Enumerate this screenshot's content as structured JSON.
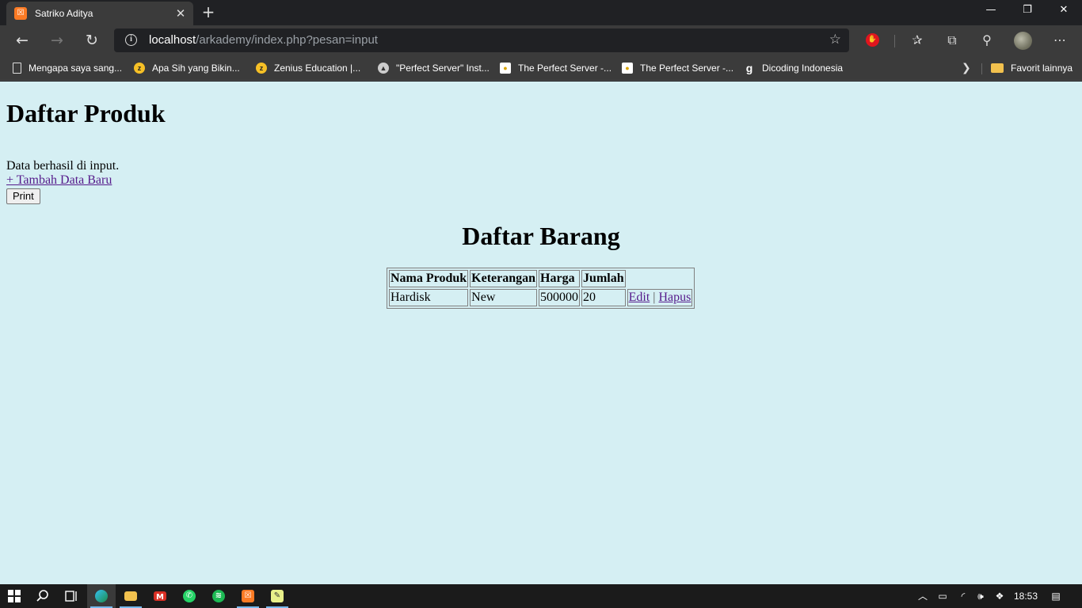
{
  "browser": {
    "tab_title": "Satriko Aditya",
    "url_host": "localhost",
    "url_path": "/arkademy/index.php?pesan=input"
  },
  "bookmarks": [
    {
      "label": "Mengapa saya sang...",
      "icon": "page-icon"
    },
    {
      "label": "Apa Sih yang Bikin...",
      "icon": "zenius-icon"
    },
    {
      "label": "Zenius Education |...",
      "icon": "zenius-icon"
    },
    {
      "label": "\"Perfect Server\" Inst...",
      "icon": "compass-icon"
    },
    {
      "label": "The Perfect Server -...",
      "icon": "bulb-icon"
    },
    {
      "label": "The Perfect Server -...",
      "icon": "bulb-icon"
    },
    {
      "label": "Dicoding Indonesia",
      "icon": "dicoding-icon"
    }
  ],
  "bookmarks_other": "Favorit lainnya",
  "page": {
    "title": "Daftar Produk",
    "message": "Data berhasil di input.",
    "add_link": "+ Tambah Data Baru",
    "print_button": "Print",
    "section_title": "Daftar Barang",
    "table": {
      "headers": [
        "Nama Produk",
        "Keterangan",
        "Harga",
        "Jumlah"
      ],
      "rows": [
        {
          "nama": "Hardisk",
          "keterangan": "New",
          "harga": "500000",
          "jumlah": "20",
          "edit": "Edit",
          "separator": "|",
          "hapus": "Hapus"
        }
      ]
    }
  },
  "taskbar": {
    "clock": "18:53"
  },
  "colors": {
    "page_background": "#d5eff3",
    "link_visited": "#551a8b",
    "chrome_dark": "#202124",
    "chrome_toolbar": "#3b3b3b"
  }
}
